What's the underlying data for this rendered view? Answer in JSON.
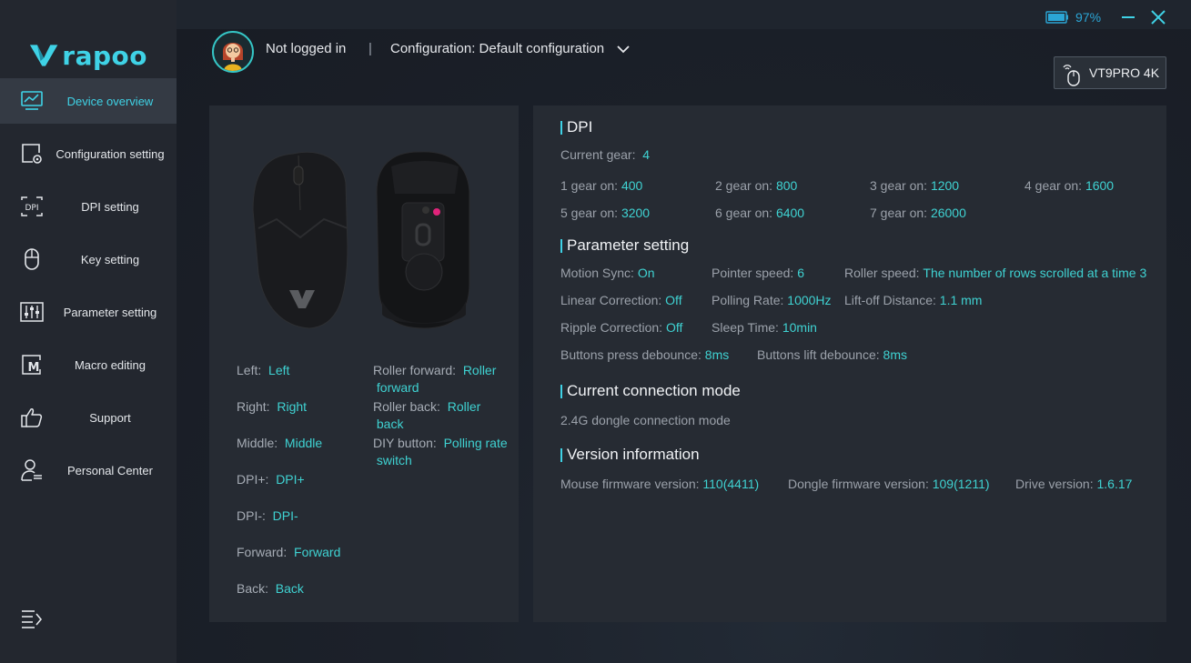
{
  "brand": {
    "logo_text": "rapoo"
  },
  "nav": [
    {
      "label": "Device overview",
      "icon": "monitor-chart-icon",
      "active": true
    },
    {
      "label": "Configuration setting",
      "icon": "config-gear-icon",
      "active": false
    },
    {
      "label": "DPI setting",
      "icon": "dpi-icon",
      "active": false
    },
    {
      "label": "Key setting",
      "icon": "mouse-icon",
      "active": false
    },
    {
      "label": "Parameter setting",
      "icon": "sliders-icon",
      "active": false
    },
    {
      "label": "Macro editing",
      "icon": "macro-icon",
      "active": false
    },
    {
      "label": "Support",
      "icon": "thumbs-up-icon",
      "active": false
    },
    {
      "label": "Personal Center",
      "icon": "user-list-icon",
      "active": false
    }
  ],
  "topbar": {
    "battery": "97%",
    "user_status": "Not logged in",
    "separator": "|",
    "configuration": "Configuration: Default configuration",
    "device": "VT9PRO 4K"
  },
  "bindings": {
    "left": [
      {
        "label": "Left:",
        "value": "Left"
      },
      {
        "label": "Right:",
        "value": "Right"
      },
      {
        "label": "Middle:",
        "value": "Middle"
      },
      {
        "label": "DPI+:",
        "value": "DPI+"
      },
      {
        "label": "DPI-:",
        "value": "DPI-"
      },
      {
        "label": "Forward:",
        "value": "Forward"
      },
      {
        "label": "Back:",
        "value": "Back"
      }
    ],
    "right": [
      {
        "label": "Roller forward:",
        "value1": "Roller",
        "value2": "forward"
      },
      {
        "label": "Roller back:",
        "value1": "Roller",
        "value2": "back"
      },
      {
        "label": "DIY button:",
        "value1": "Polling rate",
        "value2": "switch"
      }
    ]
  },
  "dpi": {
    "title": "DPI",
    "current_label": "Current gear:",
    "current_value": "4",
    "gears": [
      {
        "label": "1 gear on:",
        "value": "400"
      },
      {
        "label": "2 gear on:",
        "value": "800"
      },
      {
        "label": "3 gear on:",
        "value": "1200"
      },
      {
        "label": "4 gear on:",
        "value": "1600"
      },
      {
        "label": "5 gear on:",
        "value": "3200"
      },
      {
        "label": "6 gear on:",
        "value": "6400"
      },
      {
        "label": "7 gear on:",
        "value": "26000"
      }
    ]
  },
  "params": {
    "title": "Parameter setting",
    "motion_sync": {
      "label": "Motion Sync:",
      "value": "On"
    },
    "pointer_speed": {
      "label": "Pointer speed:",
      "value": "6"
    },
    "roller_speed": {
      "label": "Roller speed:",
      "value": "The number of rows scrolled at a time 3"
    },
    "linear_correction": {
      "label": "Linear Correction:",
      "value": "Off"
    },
    "polling_rate": {
      "label": "Polling Rate:",
      "value": "1000Hz"
    },
    "lift_off": {
      "label": "Lift-off Distance:",
      "value": "1.1 mm"
    },
    "ripple_correction": {
      "label": "Ripple Correction:",
      "value": "Off"
    },
    "sleep_time": {
      "label": "Sleep Time:",
      "value": "10min"
    },
    "press_debounce": {
      "label": "Buttons press debounce:",
      "value": "8ms"
    },
    "lift_debounce": {
      "label": "Buttons lift debounce:",
      "value": "8ms"
    }
  },
  "connection": {
    "title": "Current connection mode",
    "mode": "2.4G dongle connection mode"
  },
  "version": {
    "title": "Version information",
    "mouse_fw": {
      "label": "Mouse firmware version:",
      "value": "110(4411)"
    },
    "dongle_fw": {
      "label": "Dongle firmware version:",
      "value": "109(1211)"
    },
    "driver": {
      "label": "Drive version:",
      "value": "1.6.17"
    }
  },
  "colors": {
    "accent": "#3fd2d2",
    "sidebar": "#23272f",
    "panel": "#262b33"
  }
}
